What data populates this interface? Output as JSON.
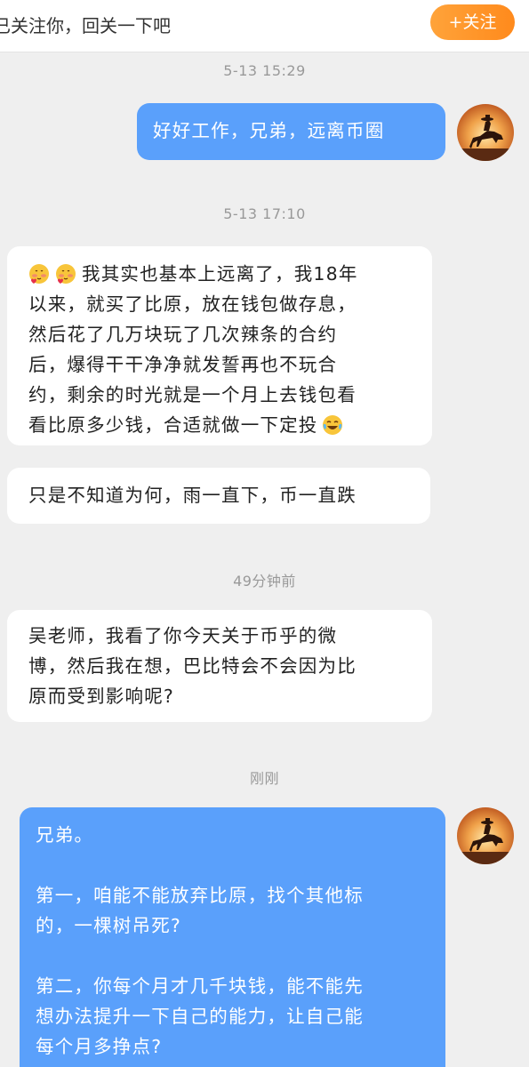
{
  "top_bar": {
    "follow_notice": "已关注你，回关一下吧",
    "follow_button": "+关注"
  },
  "messages": [
    {
      "timestamp": "5-13 15:29"
    },
    {
      "side": "right",
      "text": "好好工作，兄弟，远离币圈"
    },
    {
      "timestamp": "5-13 17:10"
    },
    {
      "side": "left",
      "lines": [
        "我其实也基本上远离了，我18年",
        "以来，就买了比原，放在钱包做存息，",
        "然后花了几万块玩了几次辣条的合约",
        "后，爆得干干净净就发誓再也不玩合",
        "约，剩余的时光就是一个月上去钱包看",
        "看比原多少钱，合适就做一下定投"
      ],
      "leading_emojis": [
        "blushing-heart-emoji",
        "blushing-heart-emoji"
      ],
      "trailing_emoji": "laughing-tears-emoji"
    },
    {
      "side": "left",
      "text": "只是不知道为何，雨一直下，币一直跌"
    },
    {
      "timestamp": "49分钟前"
    },
    {
      "side": "left",
      "lines": [
        "吴老师，我看了你今天关于币乎的微",
        "博，然后我在想，巴比特会不会因为比",
        "原而受到影响呢?"
      ]
    },
    {
      "timestamp": "刚刚"
    },
    {
      "side": "right",
      "lines": [
        "兄弟。",
        "",
        "第一，咱能不能放弃比原，找个其他标",
        "的，一棵树吊死?",
        "",
        "第二，你每个月才几千块钱，能不能先",
        "想办法提升一下自己的能力，让自己能",
        "每个月多挣点?"
      ]
    }
  ],
  "colors": {
    "background": "#efefef",
    "bubble_sent": "#5aa0fb",
    "bubble_received": "#ffffff",
    "follow_button": "#ff941f"
  },
  "avatar_icon": "cowboy-horse-sunset-avatar"
}
